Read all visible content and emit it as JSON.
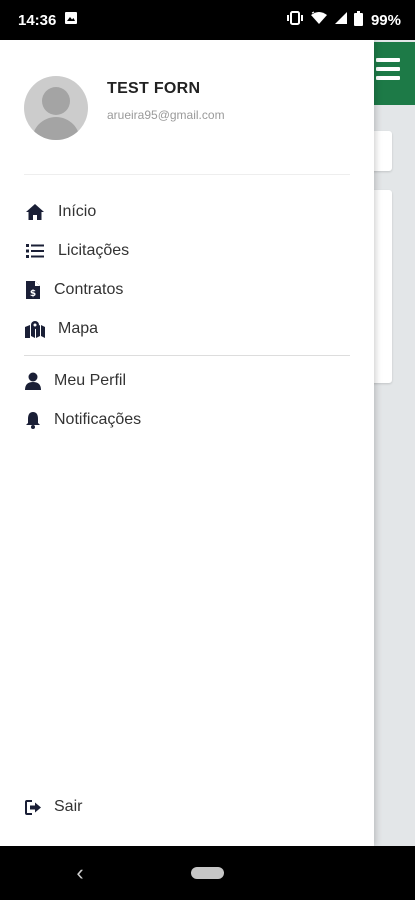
{
  "status_bar": {
    "time": "14:36",
    "battery": "99%",
    "icons": [
      "image-icon",
      "vibrate-icon",
      "wifi-icon",
      "signal-icon",
      "battery-icon"
    ]
  },
  "drawer": {
    "user": {
      "name": "TEST FORN",
      "email": "arueira95@gmail.com"
    },
    "menu_items": [
      {
        "label": "Início",
        "icon": "home-icon"
      },
      {
        "label": "Licitações",
        "icon": "list-icon"
      },
      {
        "label": "Contratos",
        "icon": "contract-icon"
      },
      {
        "label": "Mapa",
        "icon": "map-icon"
      }
    ],
    "secondary_items": [
      {
        "label": "Meu Perfil",
        "icon": "user-icon"
      },
      {
        "label": "Notificações",
        "icon": "bell-icon"
      }
    ],
    "logout_label": "Sair"
  },
  "colors": {
    "header_green": "#1d7a47",
    "icon_dark": "#1a1f36",
    "text": "#333333"
  }
}
